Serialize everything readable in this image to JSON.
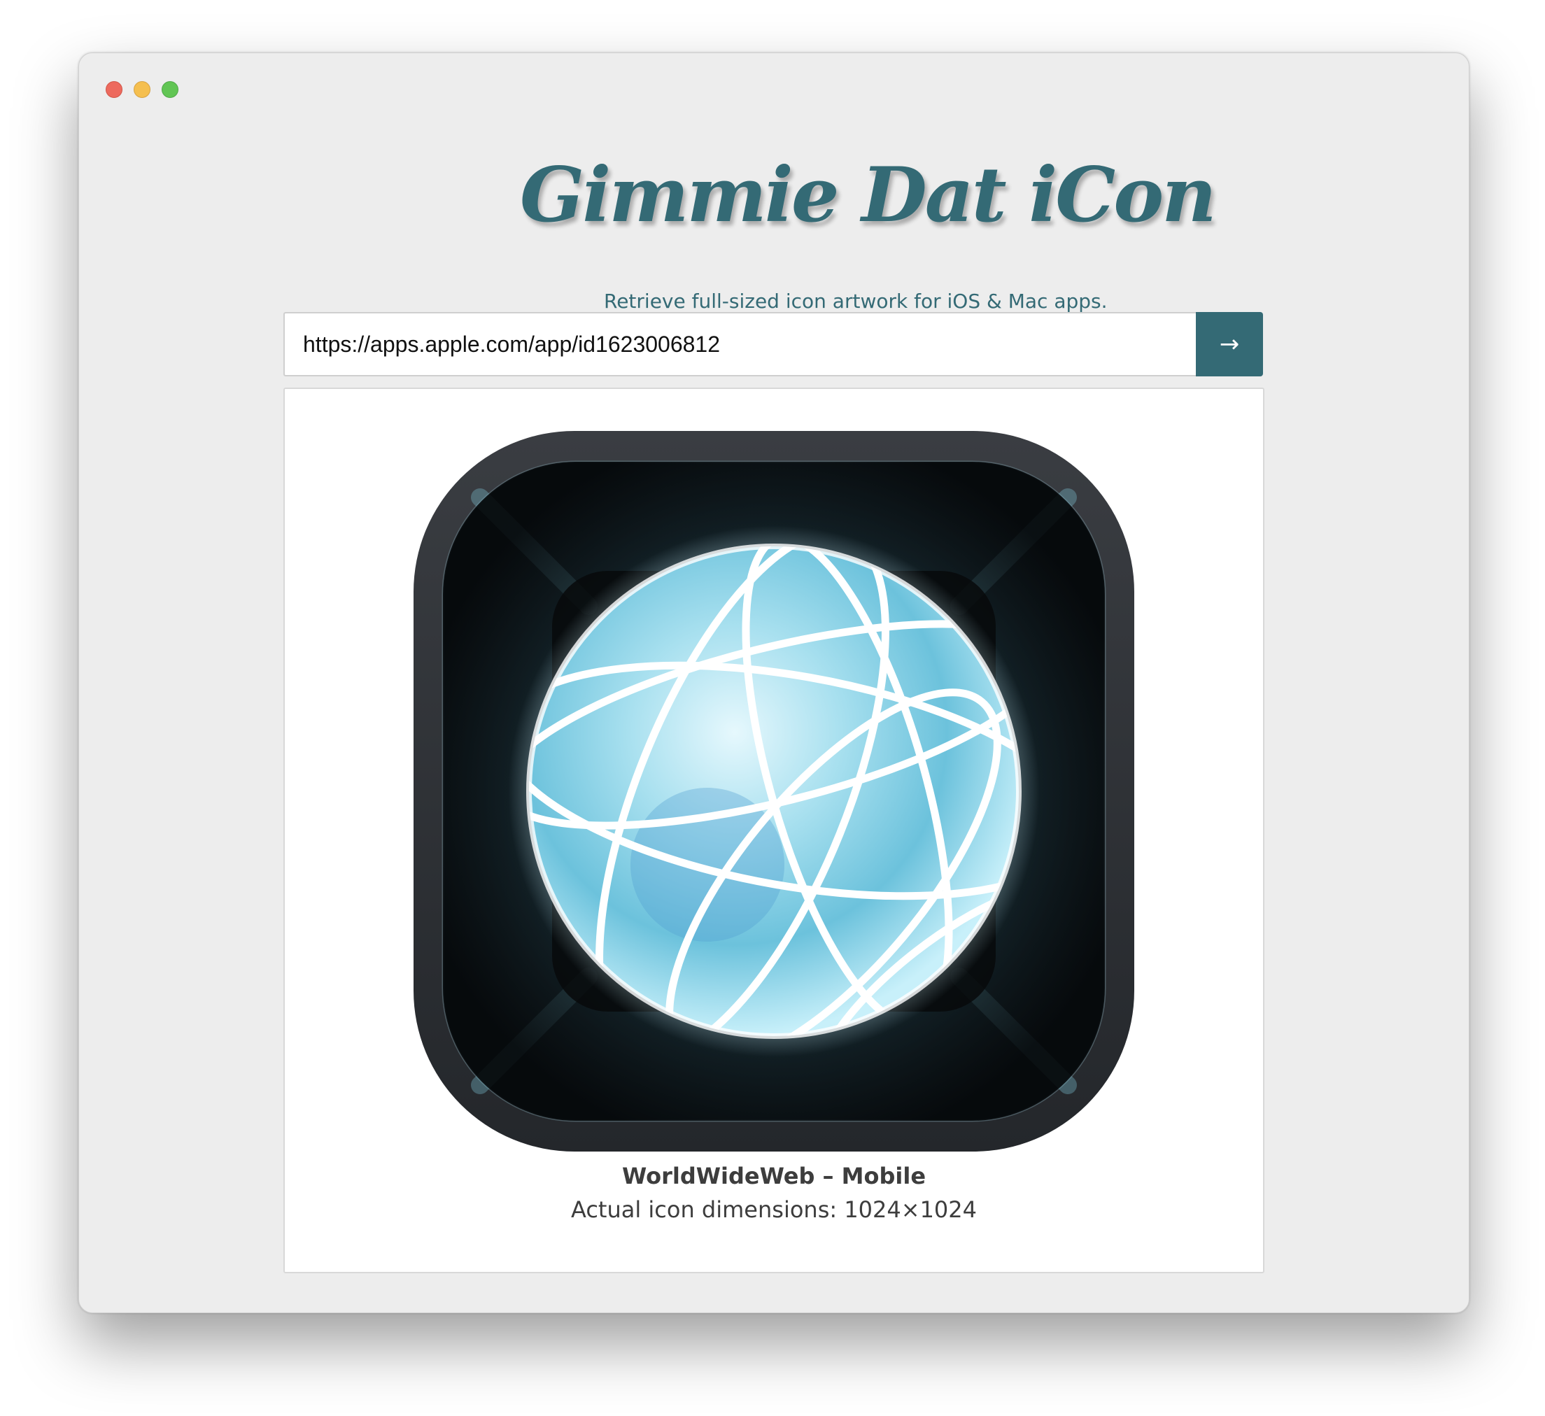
{
  "window": {
    "controls": [
      "close",
      "minimize",
      "zoom"
    ]
  },
  "header": {
    "title": "Gimmie Dat iCon",
    "subtitle": "Retrieve full-sized icon artwork for iOS & Mac apps."
  },
  "search": {
    "value": "https://apps.apple.com/app/id1623006812",
    "button_label": "→",
    "button_icon": "arrow-right-icon"
  },
  "result": {
    "app_name": "WorldWideWeb – Mobile",
    "dimensions_text": "Actual icon dimensions: 1024×1024",
    "icon": "globe-icon"
  },
  "colors": {
    "accent": "#346a75",
    "window_bg": "#ededed",
    "close": "#ed6a5e",
    "minimize": "#f5bf4f",
    "zoom": "#61c554"
  }
}
